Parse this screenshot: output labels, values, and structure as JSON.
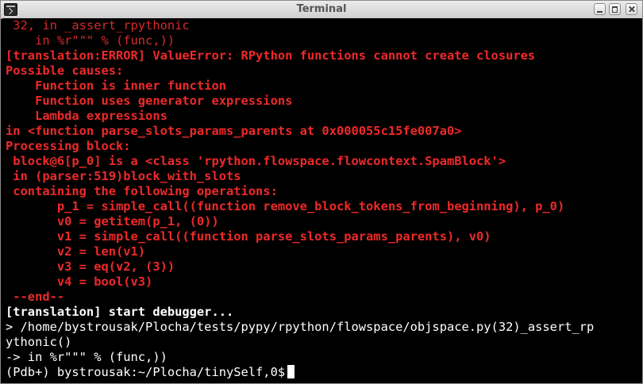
{
  "window": {
    "title": "Terminal"
  },
  "terminal": {
    "lines": [
      " 32, in _assert_rpythonic",
      "    in %r\"\"\" % (func,))",
      "[translation:ERROR] ValueError: RPython functions cannot create closures",
      "Possible causes:",
      "    Function is inner function",
      "    Function uses generator expressions",
      "    Lambda expressions",
      "in <function parse_slots_params_parents at 0x000055c15fe007a0>",
      "Processing block:",
      " block@6[p_0] is a <class 'rpython.flowspace.flowcontext.SpamBlock'>",
      " in (parser:519)block_with_slots",
      " containing the following operations:",
      "       p_1 = simple_call((function remove_block_tokens_from_beginning), p_0)",
      "       v0 = getitem(p_1, (0))",
      "       v1 = simple_call((function parse_slots_params_parents), v0)",
      "       v2 = len(v1)",
      "       v3 = eq(v2, (3))",
      "       v4 = bool(v3)",
      " --end--",
      "[translation] start debugger...",
      "> /home/bystrousak/Plocha/tests/pypy/rpython/flowspace/objspace.py(32)_assert_rp",
      "ythonic()",
      "-> in %r\"\"\" % (func,))",
      "(Pdb+) bystrousak:~/Plocha/tinySelf,0$"
    ]
  }
}
